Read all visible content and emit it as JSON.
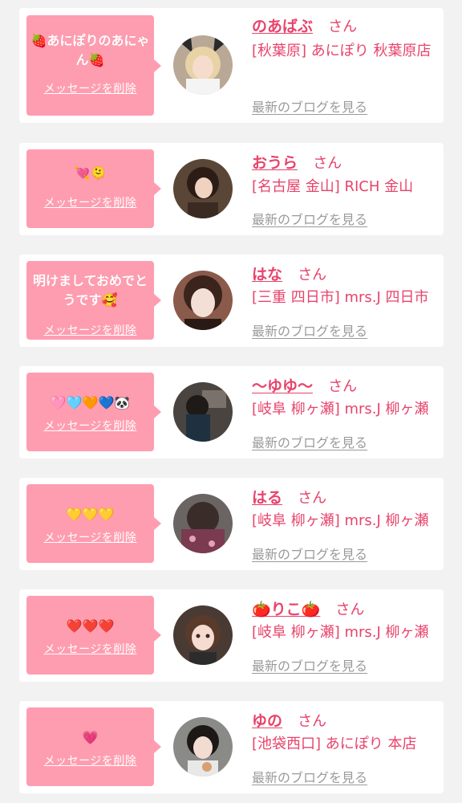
{
  "honorific": "さん",
  "delete_label": "メッセージを削除",
  "blog_label": "最新のブログを見る",
  "colors": {
    "accent": "#e8436b",
    "bubble": "#ff9db0",
    "background": "#f2f2f2",
    "link_gray": "#9a9a9a"
  },
  "entries": [
    {
      "name": "のあばぶ",
      "message": "🍓あにぽりのあにゃん🍓",
      "shop": "[秋葉原] あにぽり 秋葉原店"
    },
    {
      "name": "おうら",
      "message": "💘🫠",
      "shop": "[名古屋 金山] RICH 金山"
    },
    {
      "name": "はな",
      "message": "明けましておめでとうです🥰",
      "shop": "[三重 四日市] mrs.J 四日市"
    },
    {
      "name": "〜ゆゆ〜",
      "message": "🩷🩵🧡💙🐼",
      "shop": "[岐阜 柳ヶ瀬] mrs.J 柳ヶ瀬"
    },
    {
      "name": "はる",
      "message": "💛💛💛",
      "shop": "[岐阜 柳ヶ瀬] mrs.J 柳ヶ瀬"
    },
    {
      "name": "🍅りこ🍅",
      "message": "❤️❤️❤️",
      "shop": "[岐阜 柳ヶ瀬] mrs.J 柳ヶ瀬"
    },
    {
      "name": "ゆの",
      "message": "💗",
      "shop": "[池袋西口] あにぽり 本店"
    }
  ]
}
